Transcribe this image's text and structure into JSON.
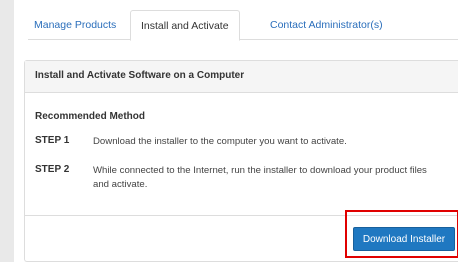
{
  "tabs": [
    {
      "label": "Manage Products"
    },
    {
      "label": "Install and Activate"
    },
    {
      "label": "Contact Administrator(s)"
    }
  ],
  "panel": {
    "heading": "Install and Activate Software on a Computer",
    "recommended_title": "Recommended Method",
    "steps": [
      {
        "label": "STEP 1",
        "text": "Download the installer to the computer you want to activate."
      },
      {
        "label": "STEP 2",
        "text": "While connected to the Internet, run the installer to download your product files and activate."
      }
    ],
    "download_button": "Download Installer"
  },
  "colors": {
    "link": "#2a6ebb",
    "button": "#1f78c1",
    "highlight": "#e00000"
  }
}
